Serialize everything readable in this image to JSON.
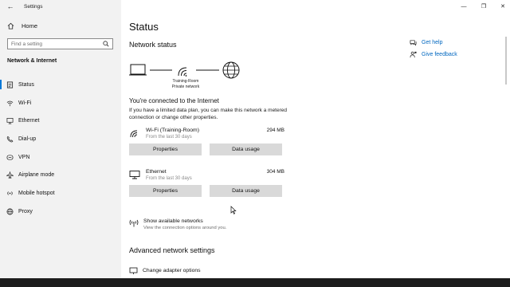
{
  "window": {
    "title": "Settings",
    "back_glyph": "←",
    "minimize_glyph": "—",
    "maximize_glyph": "❐",
    "close_glyph": "✕"
  },
  "sidebar": {
    "home_label": "Home",
    "search_placeholder": "Find a setting",
    "section_label": "Network & Internet",
    "items": [
      {
        "label": "Status",
        "icon": "status-icon"
      },
      {
        "label": "Wi-Fi",
        "icon": "wifi-icon"
      },
      {
        "label": "Ethernet",
        "icon": "ethernet-icon"
      },
      {
        "label": "Dial-up",
        "icon": "dialup-icon"
      },
      {
        "label": "VPN",
        "icon": "vpn-icon"
      },
      {
        "label": "Airplane mode",
        "icon": "airplane-icon"
      },
      {
        "label": "Mobile hotspot",
        "icon": "hotspot-icon"
      },
      {
        "label": "Proxy",
        "icon": "globe-icon"
      }
    ],
    "active_index": 0
  },
  "main": {
    "title": "Status",
    "network_status_heading": "Network status",
    "network_name": "Training-Room",
    "network_type": "Private network",
    "connected_title": "You're connected to the Internet",
    "connected_desc": "If you have a limited data plan, you can make this network a metered connection or change other properties.",
    "adapters": [
      {
        "name": "Wi-Fi (Training-Room)",
        "sub": "From the last 30 days",
        "size": "294 MB",
        "icon": "wifi-icon",
        "properties_label": "Properties",
        "data_usage_label": "Data usage"
      },
      {
        "name": "Ethernet",
        "sub": "From the last 30 days",
        "size": "304 MB",
        "icon": "ethernet-icon",
        "properties_label": "Properties",
        "data_usage_label": "Data usage"
      }
    ],
    "show_networks_title": "Show available networks",
    "show_networks_desc": "View the connection options around you.",
    "advanced_heading": "Advanced network settings",
    "change_adapter_label": "Change adapter options"
  },
  "help": {
    "get_help": "Get help",
    "give_feedback": "Give feedback"
  },
  "colors": {
    "accent": "#0078d7",
    "link": "#0067c0",
    "sidebar_bg": "#f2f2f2",
    "button_bg": "#d9d9d9"
  }
}
